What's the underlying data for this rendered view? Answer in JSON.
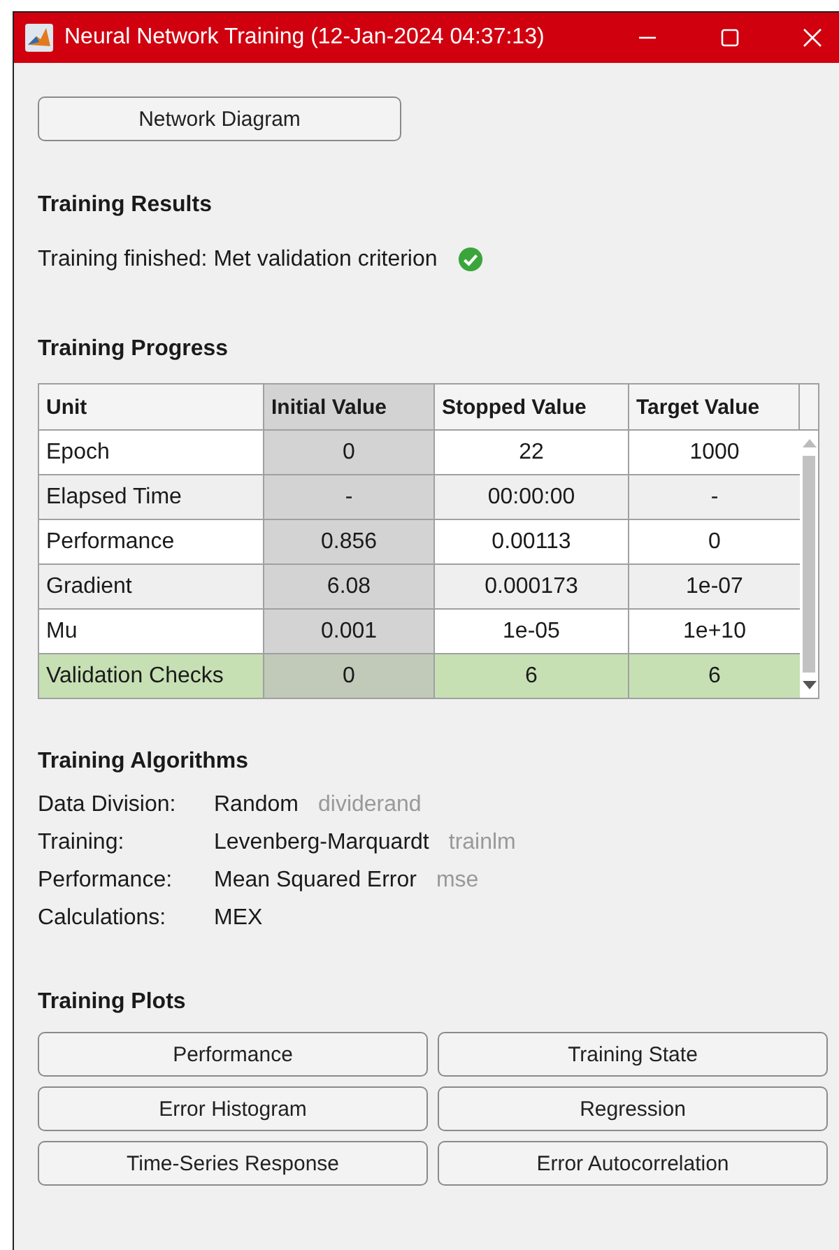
{
  "window": {
    "title": "Neural Network Training (12-Jan-2024 04:37:13)"
  },
  "diagram_button": "Network Diagram",
  "results": {
    "heading": "Training Results",
    "message": "Training finished: Met validation criterion",
    "success": true
  },
  "progress": {
    "heading": "Training Progress",
    "columns": [
      "Unit",
      "Initial Value",
      "Stopped Value",
      "Target Value"
    ],
    "rows": [
      {
        "cells": [
          "Epoch",
          "0",
          "22",
          "1000"
        ],
        "highlighted": false
      },
      {
        "cells": [
          "Elapsed Time",
          "-",
          "00:00:00",
          "-"
        ],
        "highlighted": false
      },
      {
        "cells": [
          "Performance",
          "0.856",
          "0.00113",
          "0"
        ],
        "highlighted": false
      },
      {
        "cells": [
          "Gradient",
          "6.08",
          "0.000173",
          "1e-07"
        ],
        "highlighted": false
      },
      {
        "cells": [
          "Mu",
          "0.001",
          "1e-05",
          "1e+10"
        ],
        "highlighted": false
      },
      {
        "cells": [
          "Validation Checks",
          "0",
          "6",
          "6"
        ],
        "highlighted": true
      }
    ]
  },
  "algorithms": {
    "heading": "Training Algorithms",
    "items": [
      {
        "label": "Data Division:",
        "value": "Random",
        "function": "dividerand"
      },
      {
        "label": "Training:",
        "value": "Levenberg-Marquardt",
        "function": "trainlm"
      },
      {
        "label": "Performance:",
        "value": "Mean Squared Error",
        "function": "mse"
      },
      {
        "label": "Calculations:",
        "value": "MEX"
      }
    ]
  },
  "plots": {
    "heading": "Training Plots",
    "buttons": [
      "Performance",
      "Training State",
      "Error Histogram",
      "Regression",
      "Time-Series Response",
      "Error Autocorrelation"
    ]
  }
}
